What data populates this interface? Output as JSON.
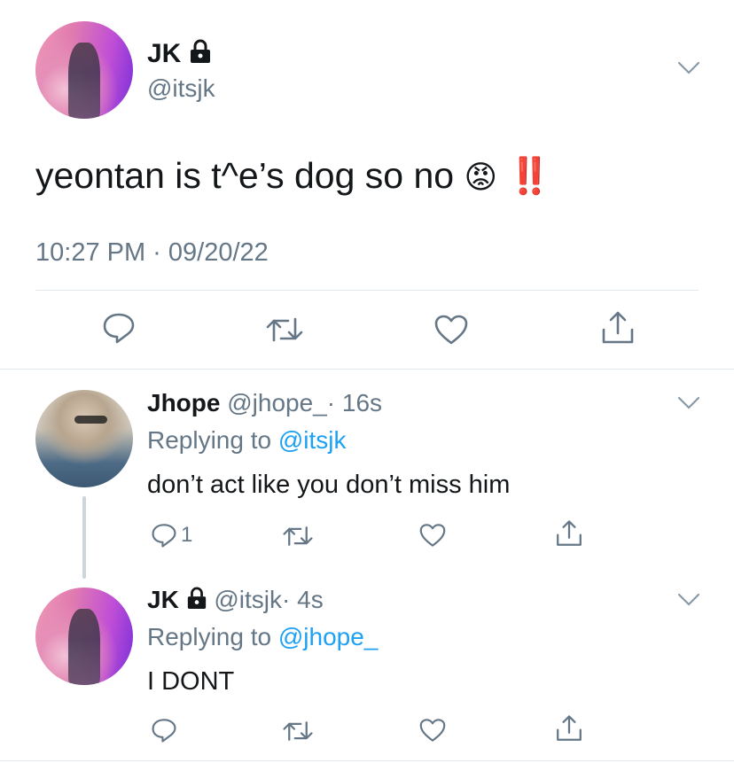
{
  "main_tweet": {
    "display_name": "JK",
    "handle": "@itsjk",
    "text": "yeontan is t^e’s dog so no",
    "emoji": "😡",
    "exclaim": "‼️",
    "timestamp": "10:27 PM · 09/20/22"
  },
  "reply_1": {
    "display_name": "Jhope",
    "handle": "@jhope_",
    "time": "· 16s",
    "replying_prefix": "Replying to",
    "replying_to": "@itsjk",
    "text": "don’t act like you don’t miss him",
    "reply_count": "1"
  },
  "reply_2": {
    "display_name": "JK",
    "handle": "@itsjk",
    "time": "· 4s",
    "replying_prefix": "Replying to",
    "replying_to": "@jhope_",
    "text": "I DONT"
  },
  "colors": {
    "accent": "#1da1f2",
    "muted": "#657786",
    "divider": "#e1e8ed",
    "thread_line": "#ccd6dd"
  },
  "icons": [
    "lock-icon",
    "chevron-down-icon",
    "reply-icon",
    "retweet-icon",
    "like-icon",
    "share-icon"
  ]
}
